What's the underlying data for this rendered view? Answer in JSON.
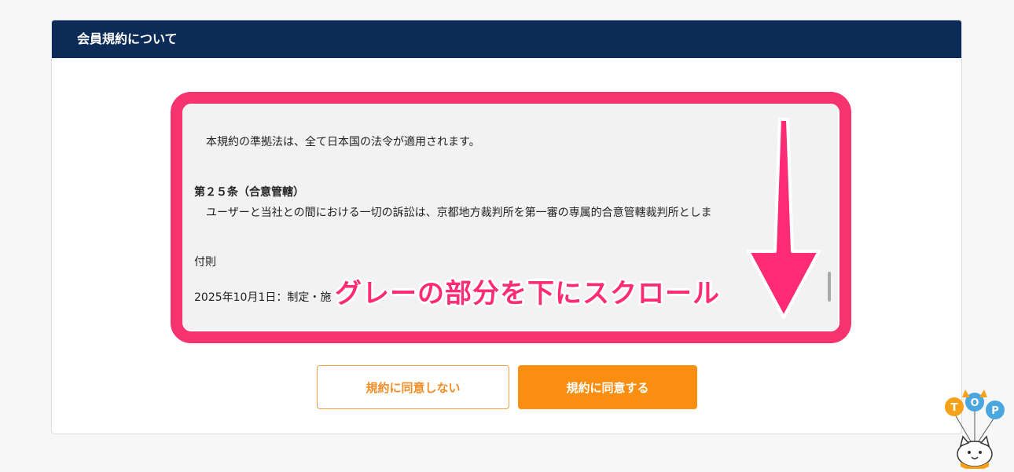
{
  "panel": {
    "title": "会員規約について"
  },
  "terms": {
    "lines": [
      "本規約の準拠法は、全て日本国の法令が適用されます。",
      "第２５条（合意管轄）",
      "ユーザーと当社との間における一切の訴訟は、京都地方裁判所を第一審の専属的合意管轄裁判所としま",
      "付則",
      "2025年10月1日：制定・施"
    ]
  },
  "annotation": {
    "text": "グレーの部分を下にスクロール",
    "color": "#f4336f"
  },
  "buttons": {
    "disagree_label": "規約に同意しない",
    "agree_label": "規約に同意する"
  },
  "top_button": {
    "balloon_letters": [
      "T",
      "O",
      "P"
    ],
    "icon": "cat-balloon-icon"
  },
  "colors": {
    "header_bg": "#0d2b57",
    "accent_orange": "#f98e10",
    "highlight_pink": "#f4336f"
  }
}
